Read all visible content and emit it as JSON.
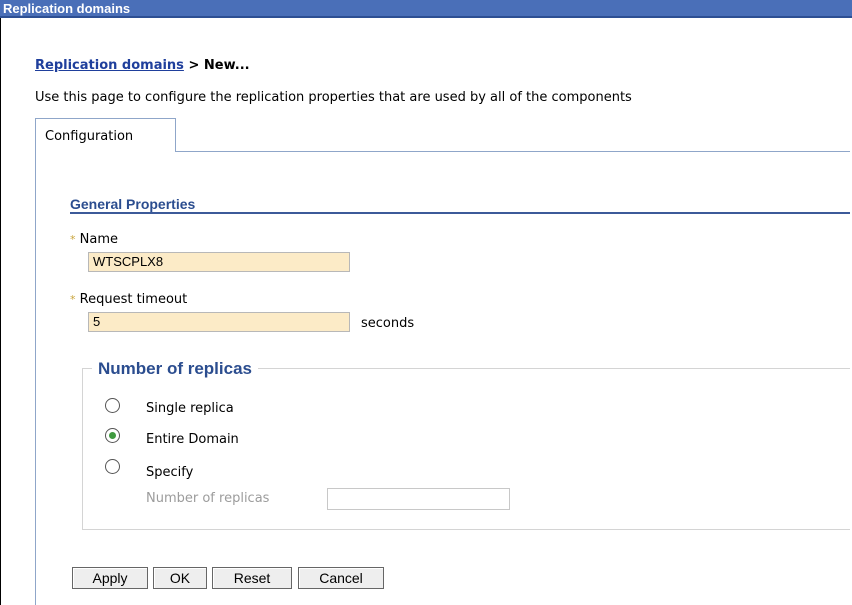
{
  "window": {
    "title": "Replication domains"
  },
  "breadcrumb": {
    "link": "Replication domains",
    "separator": " > ",
    "current": "New..."
  },
  "description": "Use this page to configure the replication properties that are used by all of the components",
  "tabs": [
    {
      "label": "Configuration"
    }
  ],
  "general_properties": {
    "title": "General Properties",
    "required_marker": "*",
    "name": {
      "label": "Name",
      "value": "WTSCPLX8"
    },
    "request_timeout": {
      "label": "Request timeout",
      "value": "5",
      "unit": "seconds"
    }
  },
  "replicas": {
    "title": "Number of replicas",
    "options": [
      {
        "label": "Single replica",
        "checked": false
      },
      {
        "label": "Entire Domain",
        "checked": true
      },
      {
        "label": "Specify",
        "checked": false
      }
    ],
    "count_field": {
      "label": "Number of replicas",
      "value": ""
    }
  },
  "buttons": {
    "apply": "Apply",
    "ok": "OK",
    "reset": "Reset",
    "cancel": "Cancel"
  },
  "colors": {
    "title_bar": "#4a6fb8",
    "link": "#1f3f9c",
    "section": "#2b4d8f",
    "input_bg": "#fcebc7",
    "radio_checked": "#3f9a3f"
  }
}
